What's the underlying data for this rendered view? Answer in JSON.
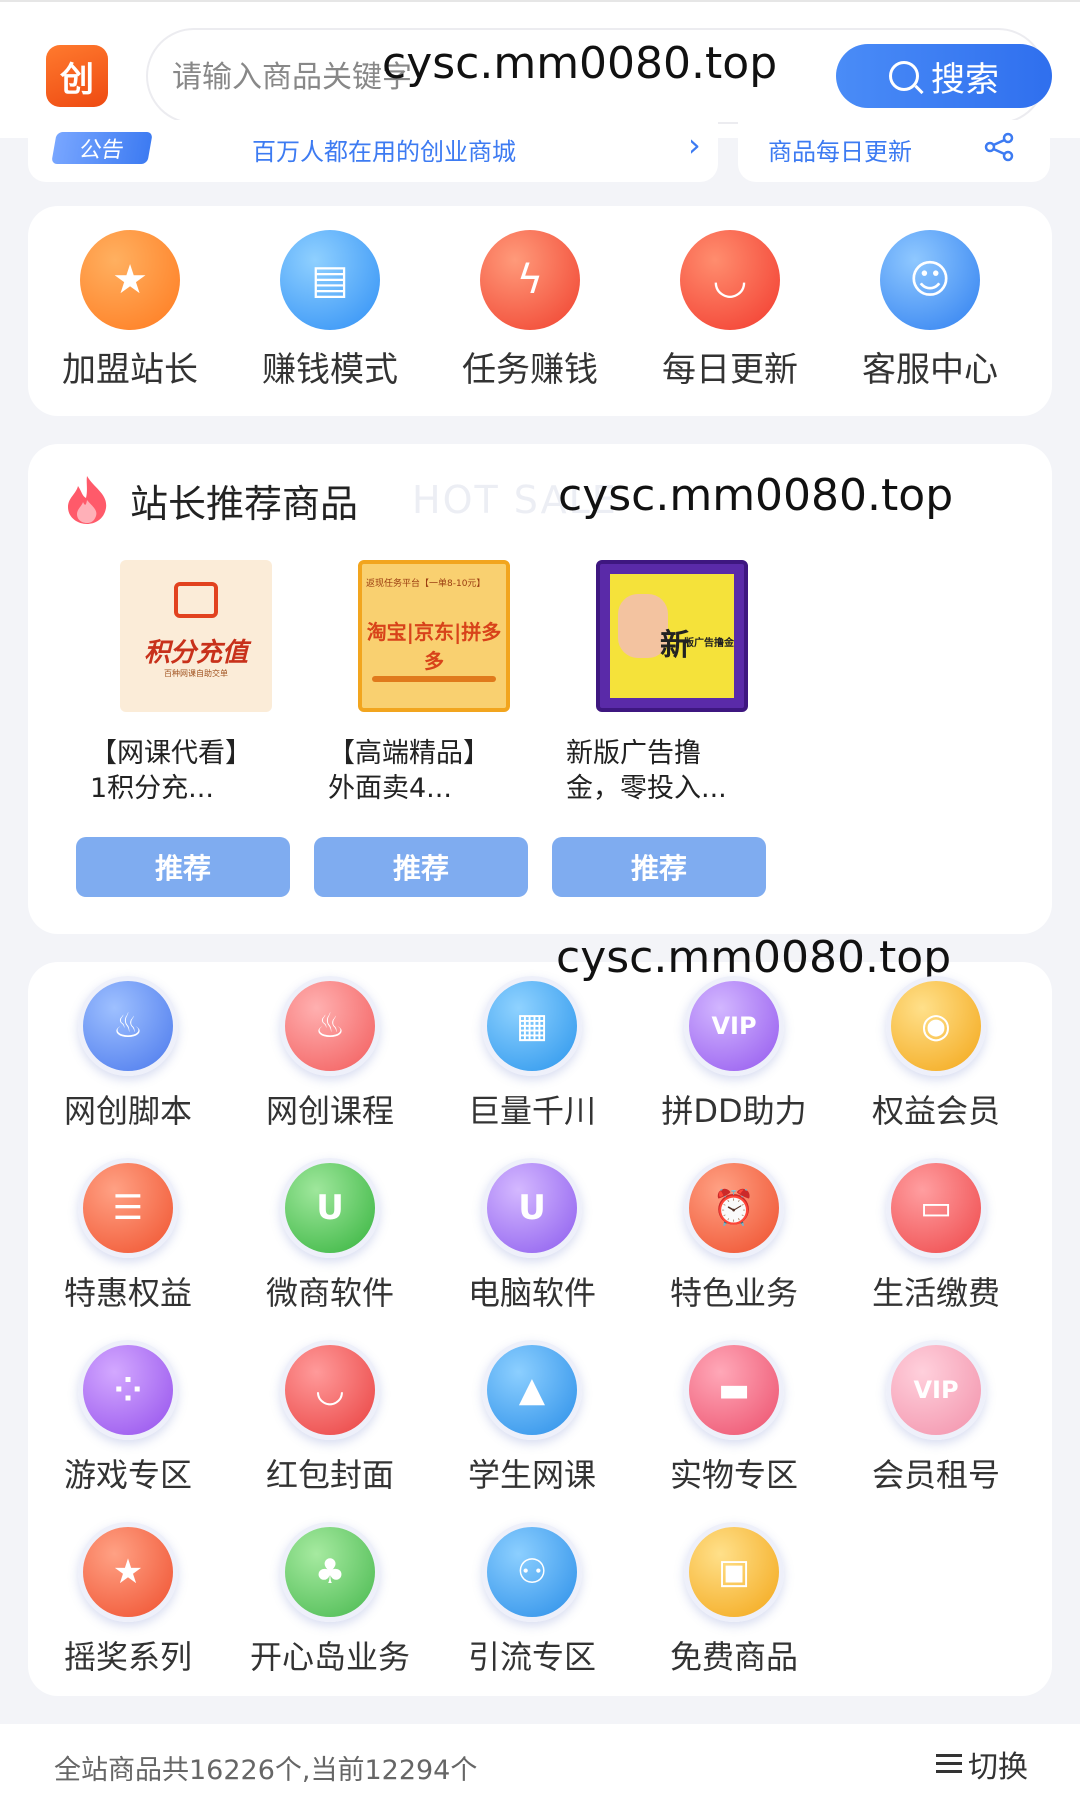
{
  "header": {
    "logo_text": "创",
    "search_placeholder": "请输入商品关键字",
    "search_button": "搜索"
  },
  "watermarks": [
    "cysc.mm0080.top",
    "cysc.mm0080.top",
    "cysc.mm0080.top"
  ],
  "notice": {
    "tag": "公告",
    "text": "百万人都在用的创业商城",
    "update_text": "商品每日更新"
  },
  "quick_nav": [
    {
      "label": "加盟站长",
      "icon": "shop-icon",
      "color": "#ff8a2a"
    },
    {
      "label": "赚钱模式",
      "icon": "document-icon",
      "color": "#3fa2f7"
    },
    {
      "label": "任务赚钱",
      "icon": "task-icon",
      "color": "#ff5a45"
    },
    {
      "label": "每日更新",
      "icon": "bag-icon",
      "color": "#ff4b3b"
    },
    {
      "label": "客服中心",
      "icon": "support-icon",
      "color": "#2f8ff5"
    }
  ],
  "recommend": {
    "title": "站长推荐商品",
    "subtitle": "HOT SALE",
    "button_label": "推荐",
    "products": [
      {
        "name_line1": "【网课代看】",
        "name_line2": "1积分充...",
        "image_text": "积分充值",
        "image_subtext": "百种网课自助交单"
      },
      {
        "name_line1": "【高端精品】",
        "name_line2": "外面卖4...",
        "image_text": "淘宝|京东|拼多多",
        "image_subtext": "返现任务平台【一单8-10元】"
      },
      {
        "name_line1": "新版广告撸",
        "name_line2": "金，零投入...",
        "image_text": "新",
        "image_subtext": "版广告撸金"
      }
    ]
  },
  "categories": [
    {
      "label": "网创脚本",
      "icon": "flame-icon",
      "color": "#5b8ef5"
    },
    {
      "label": "网创课程",
      "icon": "flame-icon",
      "color": "#ff6b6b"
    },
    {
      "label": "巨量千川",
      "icon": "grid-icon",
      "color": "#3aa6f5"
    },
    {
      "label": "拼DD助力",
      "icon": "vip-star-icon",
      "color": "#a46cf5"
    },
    {
      "label": "权益会员",
      "icon": "coins-icon",
      "color": "#f6b21f"
    },
    {
      "label": "特惠权益",
      "icon": "ticket-icon",
      "color": "#f5603c"
    },
    {
      "label": "微商软件",
      "icon": "bag-icon",
      "color": "#43c24a"
    },
    {
      "label": "电脑软件",
      "icon": "bag-icon",
      "color": "#9a6cf2"
    },
    {
      "label": "特色业务",
      "icon": "alarm-icon",
      "color": "#f5603c"
    },
    {
      "label": "生活缴费",
      "icon": "wallet-icon",
      "color": "#f5575a"
    },
    {
      "label": "游戏专区",
      "icon": "gamepad-icon",
      "color": "#a15ef0"
    },
    {
      "label": "红包封面",
      "icon": "red-packet-icon",
      "color": "#f04f4f"
    },
    {
      "label": "学生网课",
      "icon": "graduation-icon",
      "color": "#2f9cf0"
    },
    {
      "label": "实物专区",
      "icon": "gift-icon",
      "color": "#f05f7a"
    },
    {
      "label": "会员租号",
      "icon": "vip-star-icon",
      "color": "#f59ab0"
    },
    {
      "label": "摇奖系列",
      "icon": "award-icon",
      "color": "#f5603c"
    },
    {
      "label": "开心岛业务",
      "icon": "tree-icon",
      "color": "#55c25a"
    },
    {
      "label": "引流专区",
      "icon": "people-icon",
      "color": "#3a9af0"
    },
    {
      "label": "免费商品",
      "icon": "giftbox-icon",
      "color": "#f6b21f"
    }
  ],
  "footer": {
    "summary": "全站商品共16226个,当前12294个",
    "switch_label": "切换"
  }
}
